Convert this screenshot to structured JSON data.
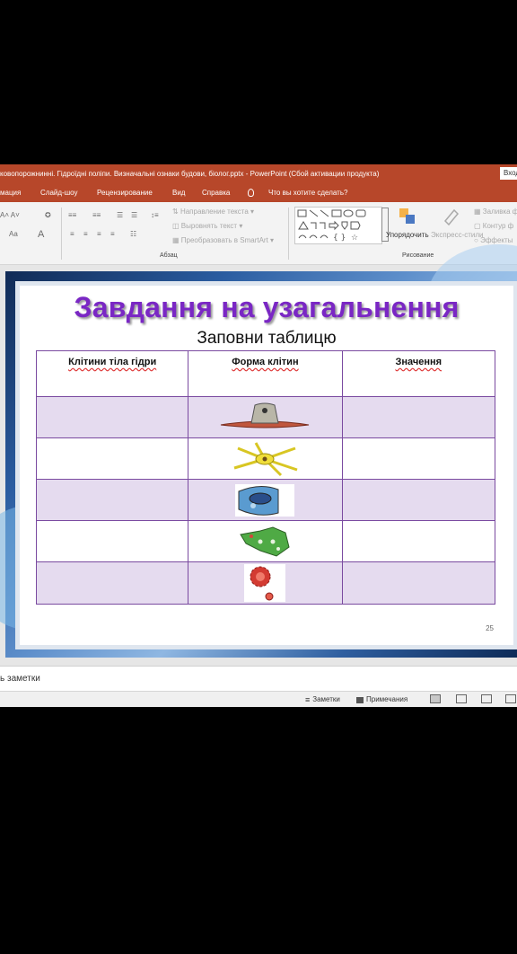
{
  "window": {
    "title": "ковопорожнинні. Гідроїдні поліпи. Визначальні ознаки будови, біолог.pptx  -  PowerPoint (Сбой активации продукта)",
    "signin_label": "Вход"
  },
  "ribbon_tabs": [
    "мация",
    "Слайд-шоу",
    "Рецензирование",
    "Вид",
    "Справка"
  ],
  "tell_me": "Что вы хотите сделать?",
  "ribbon": {
    "text_direction": "Направление текста",
    "align_text": "Выровнять текст",
    "smartart": "Преобразовать в SmartArt",
    "arrange": "Упорядочить",
    "quick_styles": "Экспресс-стили",
    "fill": "Заливка ф",
    "outline": "Контур ф",
    "effects": "Эффекты",
    "group_paragraph": "Абзац",
    "group_drawing": "Рисование",
    "font_a": "Aa"
  },
  "slide": {
    "title": "Завдання на узагальнення",
    "subtitle": "Заповни таблицю",
    "number": "25",
    "table": {
      "headers": [
        "Клітини тіла гідри",
        "Форма клітин",
        "Значення"
      ],
      "row_count": 5,
      "cell_images": [
        "epithelial-muscle-cell",
        "nerve-cell",
        "glandular-cell",
        "stinging-cell",
        "interstitial-cell"
      ]
    }
  },
  "notes_placeholder": "ь заметки",
  "status": {
    "notes": "Заметки",
    "comments": "Примечания"
  },
  "colors": {
    "titlebar": "#b7472a",
    "title_purple": "#7a27c4",
    "table_border": "#7a4aa0",
    "row_shade": "#e5dbef"
  }
}
